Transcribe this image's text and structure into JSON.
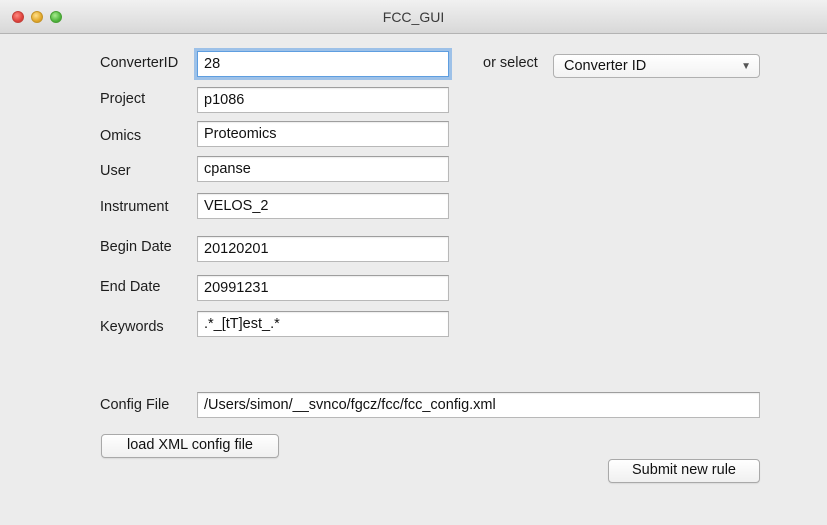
{
  "window": {
    "title": "FCC_GUI"
  },
  "form": {
    "converter_id": {
      "label": "ConverterID",
      "value": "28"
    },
    "or_select_label": "or select",
    "converter_select": {
      "selected": "Converter ID"
    },
    "project": {
      "label": "Project",
      "value": "p1086"
    },
    "omics": {
      "label": "Omics",
      "value": "Proteomics"
    },
    "user": {
      "label": "User",
      "value": "cpanse"
    },
    "instrument": {
      "label": "Instrument",
      "value": "VELOS_2"
    },
    "begin_date": {
      "label": "Begin Date",
      "value": "20120201"
    },
    "end_date": {
      "label": "End Date",
      "value": "20991231"
    },
    "keywords": {
      "label": "Keywords",
      "value": ".*_[tT]est_.*"
    },
    "config_file": {
      "label": "Config File",
      "value": "/Users/simon/__svnco/fgcz/fcc/fcc_config.xml"
    }
  },
  "buttons": {
    "load_xml": "load XML config file",
    "submit": "Submit new rule"
  }
}
